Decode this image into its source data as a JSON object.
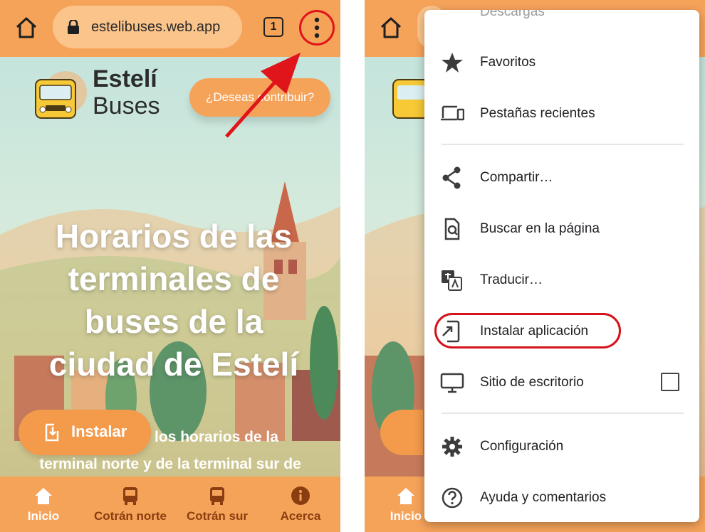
{
  "left": {
    "browser": {
      "url": "estelibuses.web.app",
      "tab_count": "1"
    },
    "header": {
      "brand_line1": "Estelí",
      "brand_line2": "Buses",
      "contribute_label": "¿Deseas contribuir?"
    },
    "hero": {
      "title_lines": [
        "Horarios de las",
        "terminales de",
        "buses de la",
        "ciudad de Estelí"
      ],
      "subtitle_lines": [
        "los horarios de la",
        "terminal norte y de la terminal sur de"
      ],
      "install_label": "Instalar"
    },
    "bottom_nav": [
      {
        "label": "Inicio",
        "icon": "home-icon",
        "active": true
      },
      {
        "label": "Cotrán norte",
        "icon": "bus-icon",
        "active": false
      },
      {
        "label": "Cotrán sur",
        "icon": "bus-icon",
        "active": false
      },
      {
        "label": "Acerca",
        "icon": "info-icon",
        "active": false
      }
    ]
  },
  "right": {
    "bottom_nav": [
      {
        "label": "Inicio",
        "icon": "home-icon",
        "active": true
      }
    ],
    "menu": {
      "partial_item": "Descargas",
      "items": [
        {
          "label": "Favoritos",
          "icon": "star-icon"
        },
        {
          "label": "Pestañas recientes",
          "icon": "devices-icon"
        },
        {
          "label": "Compartir…",
          "icon": "share-icon"
        },
        {
          "label": "Buscar en la página",
          "icon": "find-in-page-icon"
        },
        {
          "label": "Traducir…",
          "icon": "translate-icon"
        },
        {
          "label": "Instalar aplicación",
          "icon": "install-app-icon"
        },
        {
          "label": "Sitio de escritorio",
          "icon": "desktop-icon",
          "checked": false
        },
        {
          "label": "Configuración",
          "icon": "gear-icon"
        },
        {
          "label": "Ayuda y comentarios",
          "icon": "help-icon"
        }
      ]
    }
  },
  "colors": {
    "orange": "#f6a35a",
    "annotation_red": "#e0141b",
    "text_dark": "#202124"
  }
}
